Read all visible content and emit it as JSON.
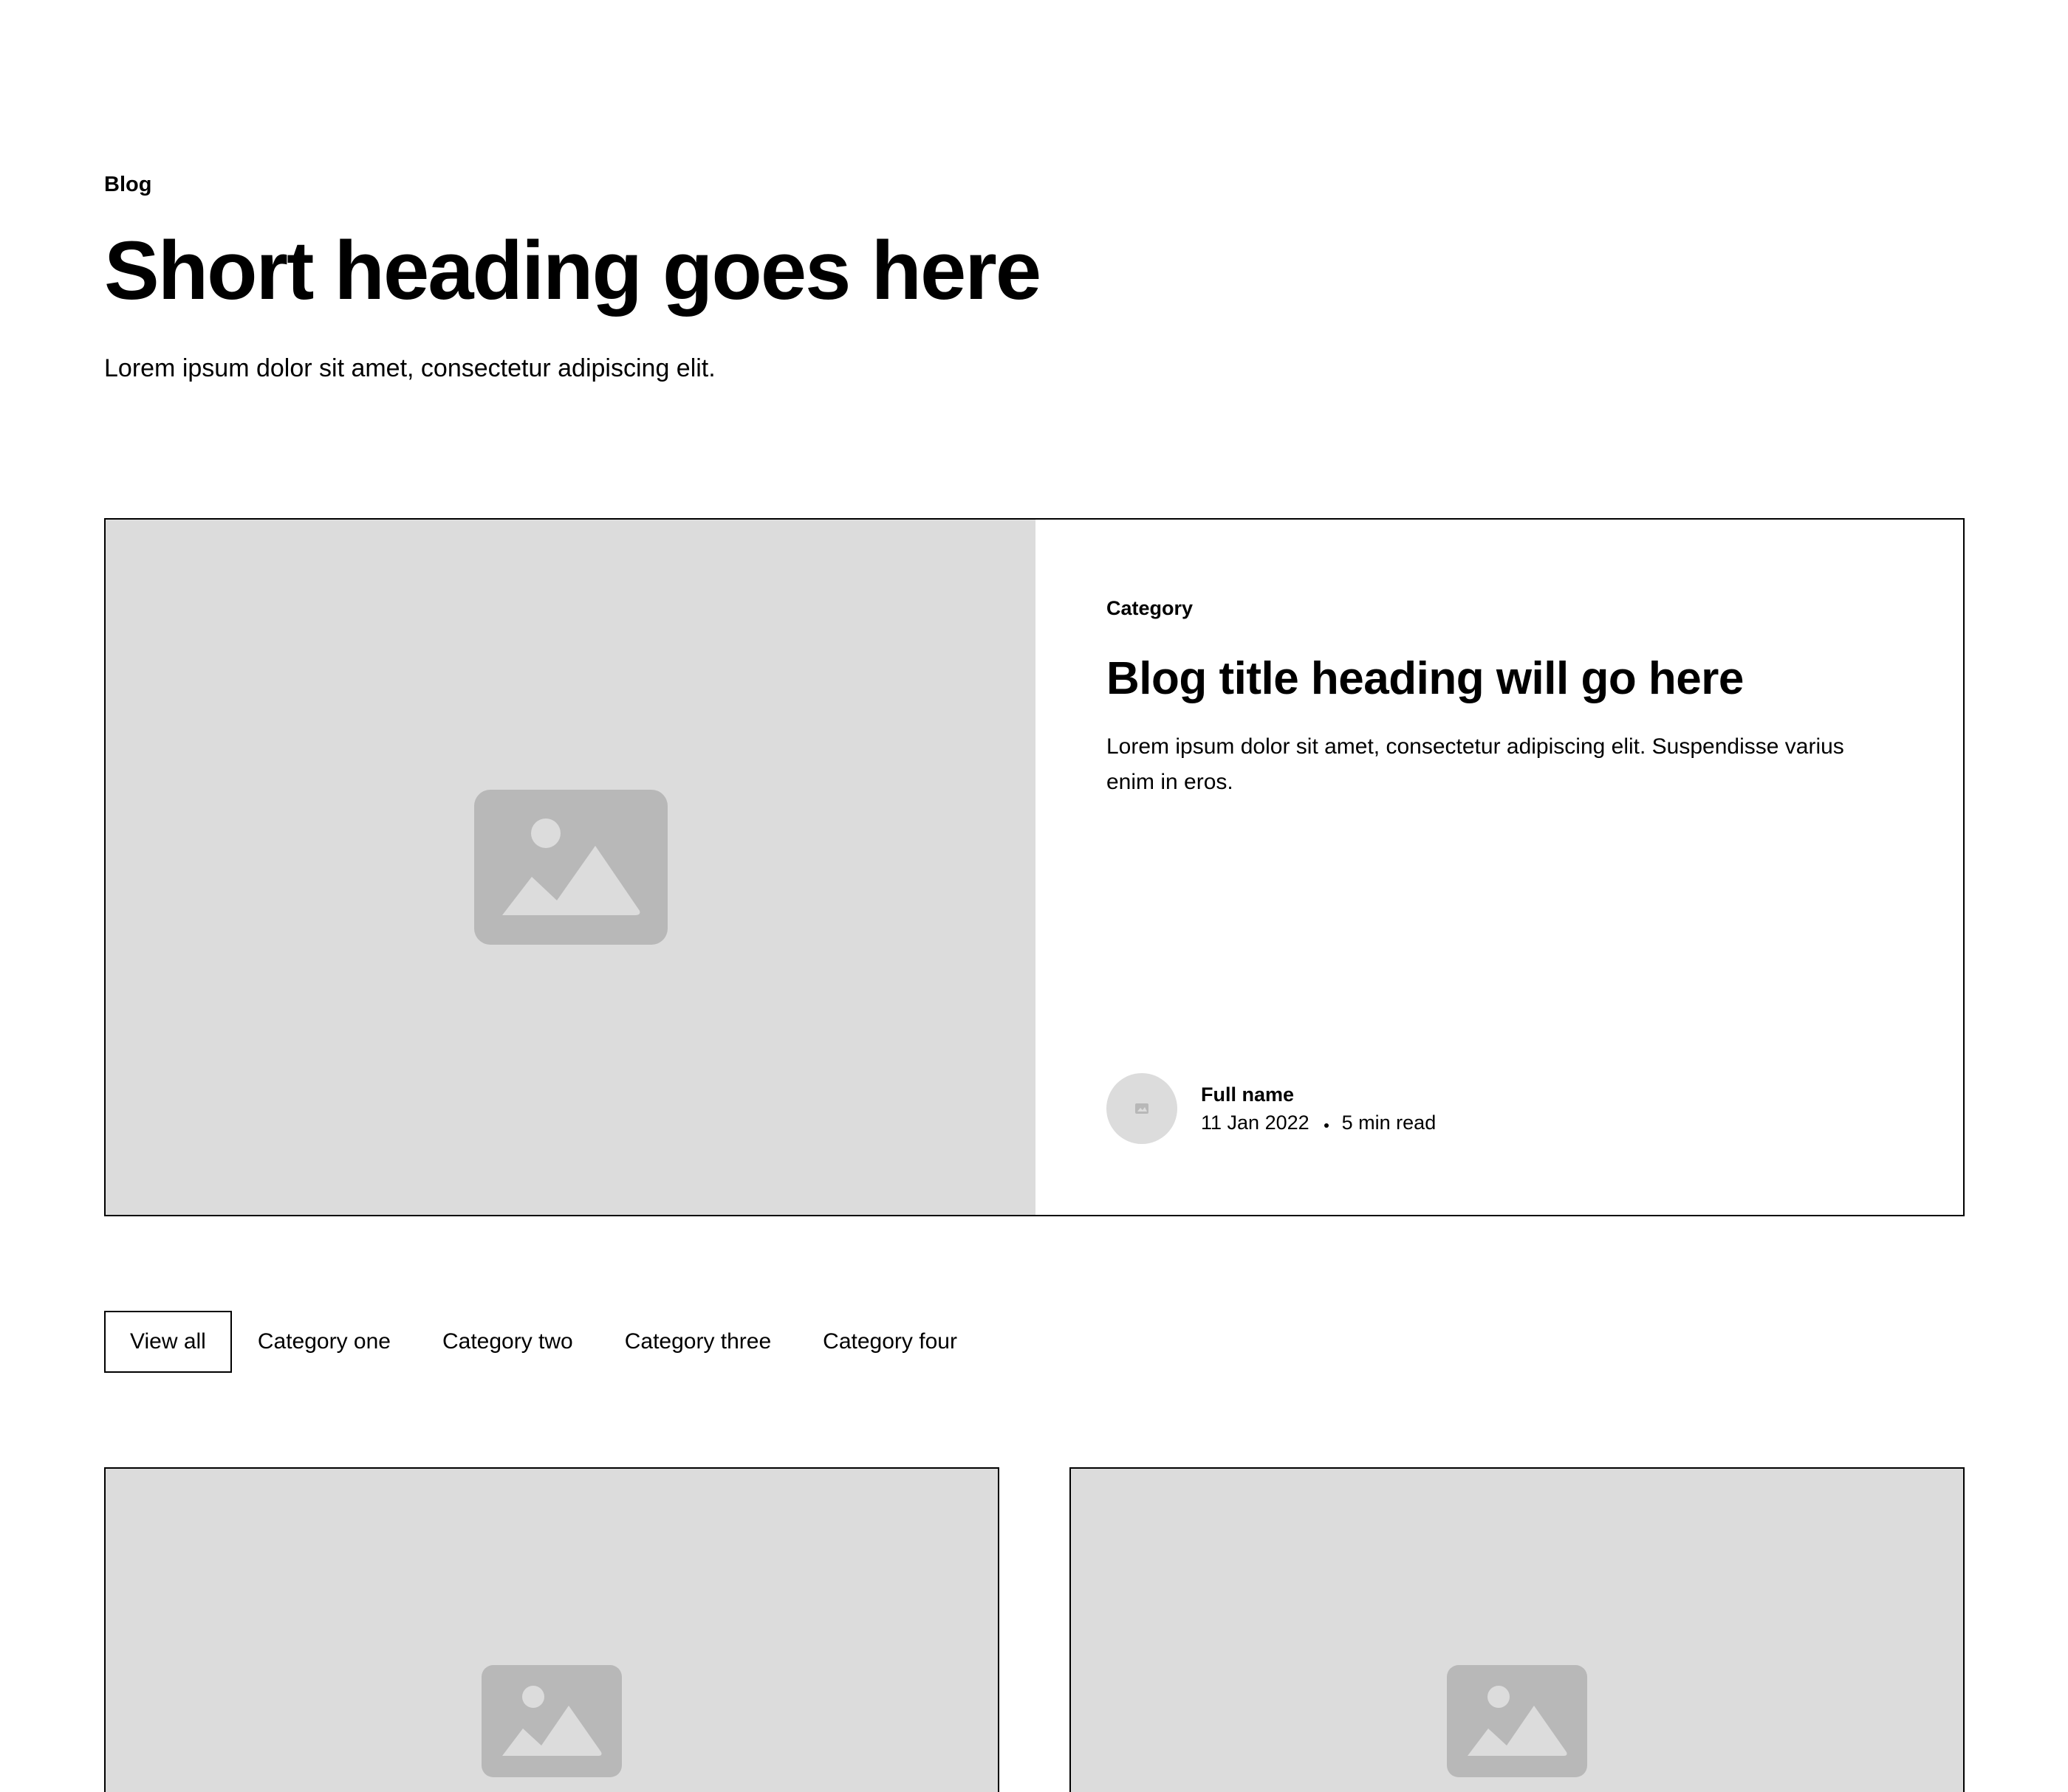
{
  "header": {
    "eyebrow": "Blog",
    "title": "Short heading goes here",
    "subtitle": "Lorem ipsum dolor sit amet, consectetur adipiscing elit."
  },
  "featured": {
    "image_icon": "image-placeholder-icon",
    "category": "Category",
    "title": "Blog title heading will go here",
    "excerpt": "Lorem ipsum dolor sit amet, consectetur adipiscing elit. Suspendisse varius enim in eros.",
    "author": {
      "name": "Full name",
      "date": "11 Jan 2022",
      "read_time": "5 min read"
    }
  },
  "tabs": [
    {
      "label": "View all",
      "active": true
    },
    {
      "label": "Category one",
      "active": false
    },
    {
      "label": "Category two",
      "active": false
    },
    {
      "label": "Category three",
      "active": false
    },
    {
      "label": "Category four",
      "active": false
    }
  ],
  "colors": {
    "placeholder_bg": "#dcdcdc",
    "placeholder_icon": "#b8b8b8",
    "border": "#000000",
    "text": "#000000"
  }
}
